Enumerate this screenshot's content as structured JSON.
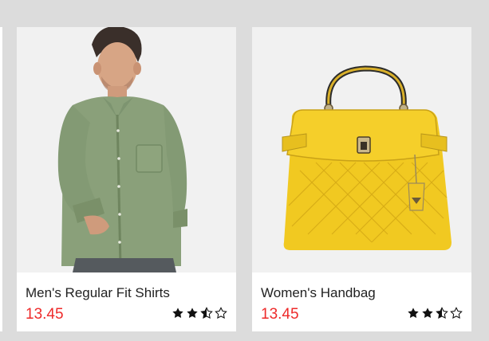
{
  "products": [
    {
      "name": "Men's Regular Fit Shirts",
      "price": "13.45",
      "rating": 2.5,
      "max_rating": 5,
      "image": "man-green-shirt-photo"
    },
    {
      "name": "Women's Handbag",
      "price": "13.45",
      "rating": 2.5,
      "max_rating": 5,
      "image": "yellow-handbag-photo"
    }
  ],
  "colors": {
    "background": "#dcdcdc",
    "card": "#ffffff",
    "price": "#ee2a2a",
    "star": "#111111"
  }
}
